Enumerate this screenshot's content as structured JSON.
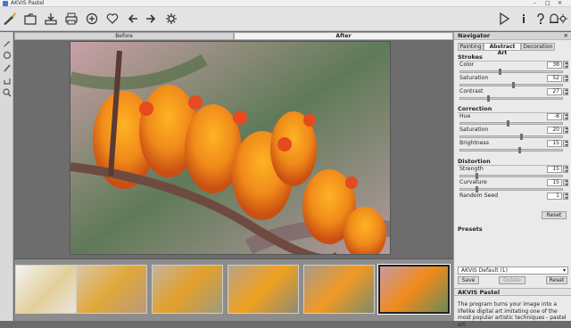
{
  "window": {
    "title": "AKVIS Pastel",
    "controls": [
      "–",
      "□",
      "✕"
    ]
  },
  "toolbar": {
    "left_icons": [
      "brush-logo-icon",
      "open-icon",
      "save-icon",
      "print-icon",
      "share-icon",
      "heart-icon",
      "back-icon",
      "forward-icon",
      "settings-icon"
    ],
    "right_icons": [
      "run-icon",
      "info-icon",
      "help-icon",
      "bell-icon",
      "gear-icon"
    ]
  },
  "canvas_tabs": {
    "before": "Before",
    "after": "After"
  },
  "navigator": {
    "title": "Navigator"
  },
  "panel_tabs": [
    "Painting",
    "Abstract Art",
    "Decoration"
  ],
  "strokes": {
    "title": "Strokes",
    "params": [
      {
        "label": "Color",
        "value": "38",
        "fraction": 0.38
      },
      {
        "label": "Saturation",
        "value": "52",
        "fraction": 0.52
      },
      {
        "label": "Contrast",
        "value": "27",
        "fraction": 0.27
      }
    ]
  },
  "correction": {
    "title": "Correction",
    "params": [
      {
        "label": "Hue",
        "value": "-8",
        "fraction": 0.46
      },
      {
        "label": "Saturation",
        "value": "20",
        "fraction": 0.6
      },
      {
        "label": "Brightness",
        "value": "15",
        "fraction": 0.58
      }
    ]
  },
  "distortion": {
    "title": "Distortion",
    "params": [
      {
        "label": "Strength",
        "value": "15",
        "fraction": 0.15
      },
      {
        "label": "Curvature",
        "value": "15",
        "fraction": 0.15
      },
      {
        "label": "Random Seed",
        "value": "1"
      }
    ],
    "reset": "Reset"
  },
  "presets": {
    "title": "Presets",
    "selected": "AKVIS Default (1)",
    "save": "Save",
    "delete": "Delete",
    "reset": "Reset"
  },
  "help": {
    "title": "AKVIS Pastel",
    "text": "The program turns your image into a lifelike digital art imitating one of the most popular artistic techniques - pastel art."
  }
}
